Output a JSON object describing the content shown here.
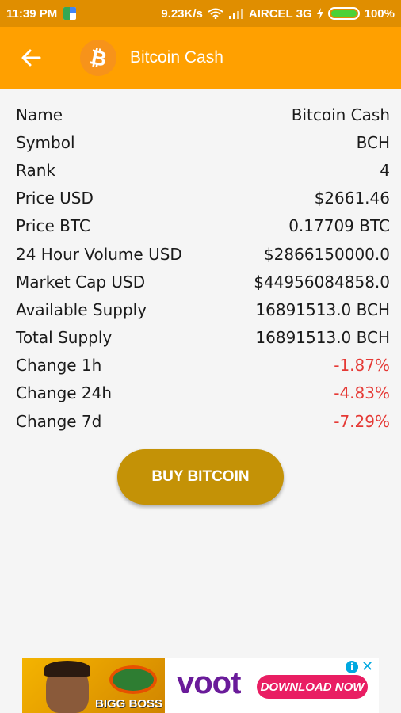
{
  "status_bar": {
    "time": "11:39 PM",
    "network_speed": "9.23K/s",
    "carrier": "AIRCEL 3G",
    "battery_text": "100%",
    "battery_level": 1.0
  },
  "app_bar": {
    "title": "Bitcoin Cash",
    "coin_symbol_glyph": "₿"
  },
  "details": [
    {
      "label": "Name",
      "value": "Bitcoin Cash"
    },
    {
      "label": "Symbol",
      "value": "BCH"
    },
    {
      "label": "Rank",
      "value": "4"
    },
    {
      "label": "Price USD",
      "value": "$2661.46"
    },
    {
      "label": "Price BTC",
      "value": "0.17709 BTC"
    },
    {
      "label": "24 Hour Volume USD",
      "value": "$2866150000.0"
    },
    {
      "label": "Market Cap USD",
      "value": "$44956084858.0"
    },
    {
      "label": "Available Supply",
      "value": "16891513.0 BCH"
    },
    {
      "label": "Total Supply",
      "value": "16891513.0 BCH"
    },
    {
      "label": "Change 1h",
      "value": "-1.87%"
    },
    {
      "label": "Change 24h",
      "value": "-4.83%"
    },
    {
      "label": "Change 7d",
      "value": "-7.29%"
    }
  ],
  "buy_button": {
    "label": "BUY BITCOIN"
  },
  "ad": {
    "show_name": "BIGG BOSS",
    "brand": "voot",
    "cta": "DOWNLOAD NOW",
    "info_glyph": "i",
    "close_glyph": "✕"
  },
  "colors": {
    "status_bar": "#e08e00",
    "app_bar": "#ffa000",
    "buy_button": "#c49206",
    "negative": "#e53935"
  }
}
